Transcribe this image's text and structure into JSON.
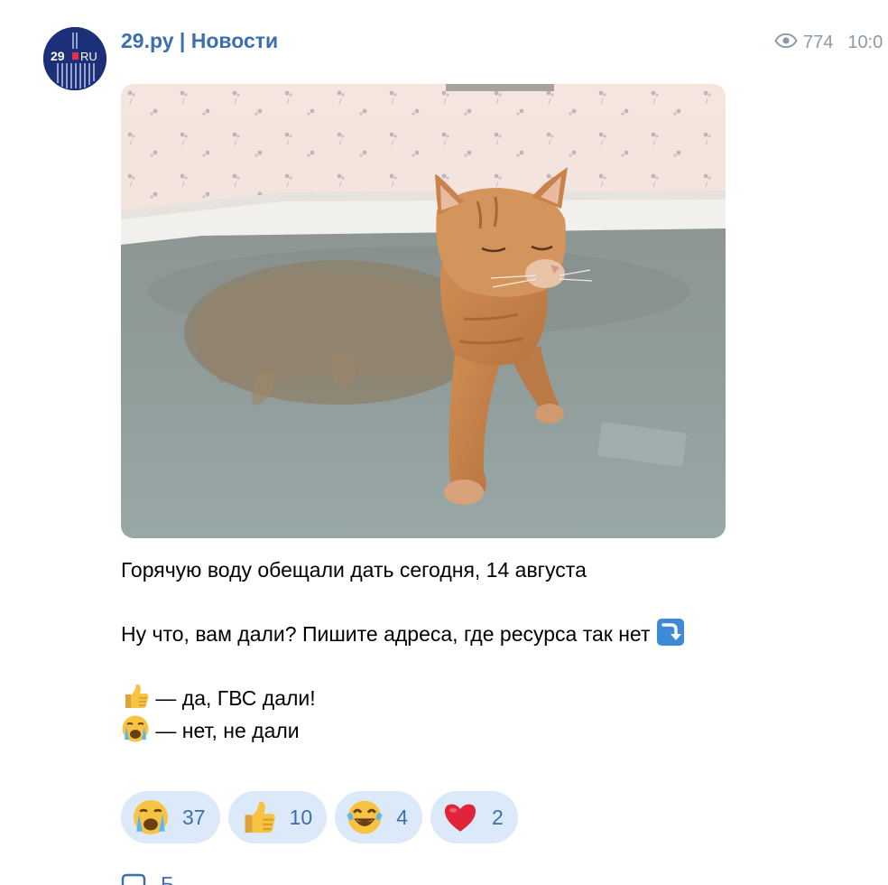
{
  "channel": {
    "name": "29.ру | Новости",
    "avatar_text_left": "29",
    "avatar_text_right": "RU"
  },
  "meta": {
    "views": "774",
    "time": "10:0"
  },
  "post": {
    "line1": "Горячую воду обещали дать сегодня, 14 августа",
    "line2": "Ну что, вам дали? Пишите адреса, где ресурса так нет",
    "line3": "— да, ГВС дали!",
    "line4": "— нет, не дали"
  },
  "reactions": [
    {
      "emoji": "crying-face",
      "count": "37"
    },
    {
      "emoji": "thumbs-up",
      "count": "10"
    },
    {
      "emoji": "tears-of-joy",
      "count": "4"
    },
    {
      "emoji": "red-heart",
      "count": "2"
    }
  ],
  "comments": {
    "label": "Б"
  },
  "colors": {
    "accent": "#3d6fae",
    "reaction_bg": "#dce9f8",
    "meta": "#8c9aa8"
  }
}
